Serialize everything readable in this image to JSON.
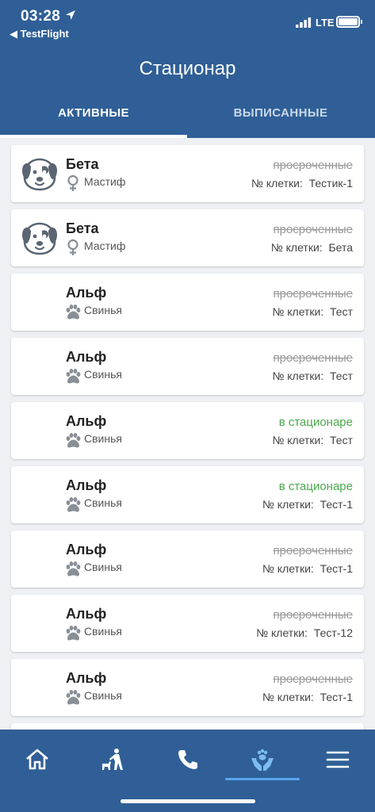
{
  "status_bar": {
    "time": "03:28",
    "back_app": "◀ TestFlight",
    "network": "LTE"
  },
  "header": {
    "title": "Стационар"
  },
  "tabs": [
    {
      "label": "АКТИВНЫЕ"
    },
    {
      "label": "ВЫПИСАННЫЕ"
    }
  ],
  "colors": {
    "header": "#2f5f96",
    "status_in": "#4aa84a",
    "status_overdue": "#9a9a9a",
    "nav_indicator": "#5aa4ee"
  },
  "patients": [
    {
      "name": "Бета",
      "breed": "Мастиф",
      "status": "просроченные",
      "cage": "№ клетки:  Тестик-1",
      "avatar": "dog-icon",
      "sub_icon": "female-icon",
      "in_hospital": false
    },
    {
      "name": "Бета",
      "breed": "Мастиф",
      "status": "просроченные",
      "cage": "№ клетки:  Бета",
      "avatar": "dog-icon",
      "sub_icon": "female-icon",
      "in_hospital": false
    },
    {
      "name": "Альф",
      "breed": "Свинья",
      "status": "просроченные",
      "cage": "№ клетки:  Тест",
      "avatar": "",
      "sub_icon": "paw-icon",
      "in_hospital": false
    },
    {
      "name": "Альф",
      "breed": "Свинья",
      "status": "просроченные",
      "cage": "№ клетки:  Тест",
      "avatar": "",
      "sub_icon": "paw-icon",
      "in_hospital": false
    },
    {
      "name": "Альф",
      "breed": "Свинья",
      "status": "в стационаре",
      "cage": "№ клетки:  Тест",
      "avatar": "",
      "sub_icon": "paw-icon",
      "in_hospital": true
    },
    {
      "name": "Альф",
      "breed": "Свинья",
      "status": "в стационаре",
      "cage": "№ клетки:  Тест-1",
      "avatar": "",
      "sub_icon": "paw-icon",
      "in_hospital": true
    },
    {
      "name": "Альф",
      "breed": "Свинья",
      "status": "просроченные",
      "cage": "№ клетки:  Тест-1",
      "avatar": "",
      "sub_icon": "paw-icon",
      "in_hospital": false
    },
    {
      "name": "Альф",
      "breed": "Свинья",
      "status": "просроченные",
      "cage": "№ клетки:  Тест-12",
      "avatar": "",
      "sub_icon": "paw-icon",
      "in_hospital": false
    },
    {
      "name": "Альф",
      "breed": "Свинья",
      "status": "просроченные",
      "cage": "№ клетки:  Тест-1",
      "avatar": "",
      "sub_icon": "paw-icon",
      "in_hospital": false
    }
  ],
  "bottom_nav": [
    {
      "icon": "home-icon"
    },
    {
      "icon": "dog-walking-icon"
    },
    {
      "icon": "phone-icon"
    },
    {
      "icon": "pet-care-hands-icon",
      "active": true
    },
    {
      "icon": "menu-icon"
    }
  ]
}
